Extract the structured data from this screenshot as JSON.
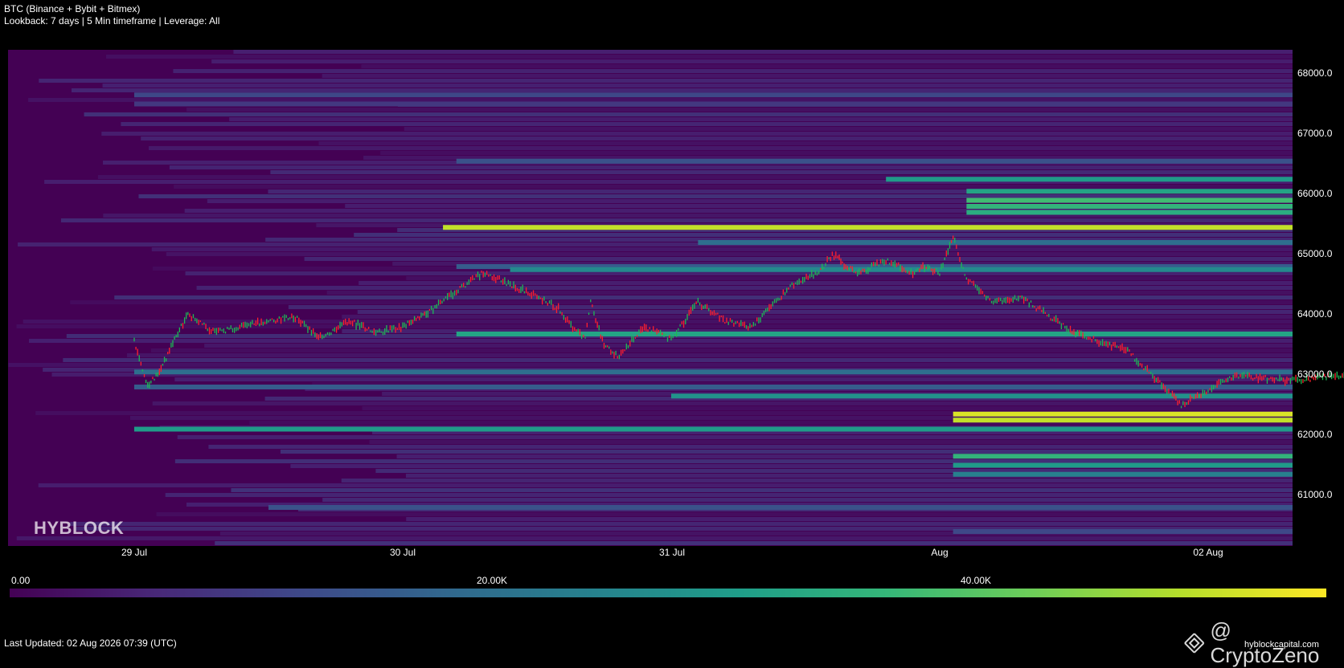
{
  "header": {
    "title": "BTC (Binance + Bybit + Bitmex)",
    "subtitle": "Lookback: 7 days | 5 Min timeframe | Leverage: All"
  },
  "chart_data": {
    "type": "heatmap",
    "title": "BTC (Binance + Bybit + Bitmex)",
    "y_range": [
      60200,
      68400
    ],
    "y_ticks": [
      "68000.0",
      "67000.0",
      "66000.0",
      "65000.0",
      "64000.0",
      "63000.0",
      "62000.0",
      "61000.0"
    ],
    "x_ticks": [
      "29 Jul",
      "30 Jul",
      "31 Jul",
      "Aug",
      "02 Aug"
    ],
    "colorbar": {
      "ticks": [
        "0.00",
        "20.00K",
        "40.00K"
      ],
      "range": [
        0,
        55000
      ],
      "colormap": "viridis"
    },
    "price_path": {
      "x_days": [
        0,
        0.05,
        0.1,
        0.15,
        0.2,
        0.3,
        0.4,
        0.5,
        0.6,
        0.7,
        0.8,
        0.9,
        1.0,
        1.05,
        1.1,
        1.2,
        1.3,
        1.4,
        1.5,
        1.58,
        1.62,
        1.68,
        1.7,
        1.75,
        1.8,
        1.9,
        2.0,
        2.1,
        2.2,
        2.3,
        2.45,
        2.55,
        2.6,
        2.62,
        2.65,
        2.7,
        2.8,
        2.9,
        2.95,
        3.0,
        3.05,
        3.1,
        3.2,
        3.3,
        3.5,
        3.7,
        3.9,
        4.0,
        4.1,
        4.2,
        4.3,
        4.5,
        4.7,
        4.9,
        5.0,
        5.2,
        5.4,
        5.6,
        5.8,
        6.0,
        6.2,
        6.3,
        6.4,
        6.5,
        6.55,
        6.65,
        6.75,
        6.85,
        6.9
      ],
      "price": [
        63550,
        62800,
        63100,
        63600,
        64000,
        63700,
        63800,
        63900,
        63950,
        63600,
        63900,
        63700,
        63800,
        63950,
        64050,
        64400,
        64700,
        64500,
        64300,
        64100,
        63850,
        63600,
        64200,
        63500,
        63300,
        63800,
        63600,
        64200,
        63900,
        63800,
        64500,
        64700,
        65000,
        64950,
        64800,
        64700,
        64900,
        64700,
        64800,
        64700,
        65300,
        64600,
        64200,
        64300,
        63700,
        63400,
        62500,
        62750,
        63000,
        62950,
        62900,
        63000,
        63050,
        63000,
        62950,
        62800,
        62900,
        63050,
        62850,
        62400,
        63300,
        63200,
        63400,
        63100,
        63200,
        63400,
        63600,
        63500,
        63450
      ]
    },
    "levels": [
      {
        "price": 67650,
        "value": 12000,
        "start_day": 0
      },
      {
        "price": 67500,
        "value": 9000,
        "start_day": 0
      },
      {
        "price": 66550,
        "value": 14000,
        "start_day": 1.2
      },
      {
        "price": 66250,
        "value": 30000,
        "start_day": 2.8
      },
      {
        "price": 66050,
        "value": 32000,
        "start_day": 3.1
      },
      {
        "price": 65900,
        "value": 38000,
        "start_day": 3.1
      },
      {
        "price": 65800,
        "value": 36000,
        "start_day": 3.1
      },
      {
        "price": 65700,
        "value": 34000,
        "start_day": 3.1
      },
      {
        "price": 65450,
        "value": 50000,
        "start_day": 1.15
      },
      {
        "price": 65200,
        "value": 20000,
        "start_day": 2.1
      },
      {
        "price": 64800,
        "value": 16000,
        "start_day": 1.2
      },
      {
        "price": 64750,
        "value": 26000,
        "start_day": 1.4
      },
      {
        "price": 63680,
        "value": 32000,
        "start_day": 1.2
      },
      {
        "price": 63050,
        "value": 20000,
        "start_day": 0
      },
      {
        "price": 62800,
        "value": 16000,
        "start_day": 0
      },
      {
        "price": 62650,
        "value": 28000,
        "start_day": 2.0
      },
      {
        "price": 62350,
        "value": 52000,
        "start_day": 3.05
      },
      {
        "price": 62250,
        "value": 50000,
        "start_day": 3.05
      },
      {
        "price": 62100,
        "value": 30000,
        "start_day": 0
      },
      {
        "price": 61650,
        "value": 36000,
        "start_day": 3.05
      },
      {
        "price": 61500,
        "value": 30000,
        "start_day": 3.05
      },
      {
        "price": 61350,
        "value": 24000,
        "start_day": 3.05
      },
      {
        "price": 60800,
        "value": 14000,
        "start_day": 0.5
      },
      {
        "price": 60400,
        "value": 12000,
        "start_day": 3.05
      }
    ]
  },
  "watermark": "HYBLOCK",
  "footer": {
    "updated": "Last Updated: 02 Aug 2026 07:39 (UTC)",
    "brand": "@ CryptoZeno",
    "site": "hyblockcapital.com"
  }
}
